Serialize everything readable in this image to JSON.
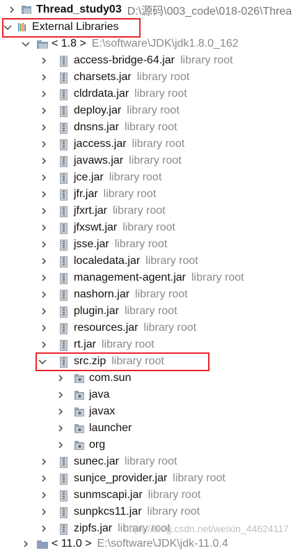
{
  "project": {
    "name": "Thread_study03",
    "path": "D:\\源码\\003_code\\018-026\\Threa"
  },
  "external_libraries": {
    "label": "External Libraries"
  },
  "jdk18": {
    "label": "< 1.8 >",
    "path": "E:\\software\\JDK\\jdk1.8.0_162"
  },
  "jars": [
    {
      "name": "access-bridge-64.jar",
      "hint": "library root"
    },
    {
      "name": "charsets.jar",
      "hint": "library root"
    },
    {
      "name": "cldrdata.jar",
      "hint": "library root"
    },
    {
      "name": "deploy.jar",
      "hint": "library root"
    },
    {
      "name": "dnsns.jar",
      "hint": "library root"
    },
    {
      "name": "jaccess.jar",
      "hint": "library root"
    },
    {
      "name": "javaws.jar",
      "hint": "library root"
    },
    {
      "name": "jce.jar",
      "hint": "library root"
    },
    {
      "name": "jfr.jar",
      "hint": "library root"
    },
    {
      "name": "jfxrt.jar",
      "hint": "library root"
    },
    {
      "name": "jfxswt.jar",
      "hint": "library root"
    },
    {
      "name": "jsse.jar",
      "hint": "library root"
    },
    {
      "name": "localedata.jar",
      "hint": "library root"
    },
    {
      "name": "management-agent.jar",
      "hint": "library root"
    },
    {
      "name": "nashorn.jar",
      "hint": "library root"
    },
    {
      "name": "plugin.jar",
      "hint": "library root"
    },
    {
      "name": "resources.jar",
      "hint": "library root"
    },
    {
      "name": "rt.jar",
      "hint": "library root"
    }
  ],
  "src_zip": {
    "name": "src.zip",
    "hint": "library root"
  },
  "packages": [
    {
      "name": "com.sun"
    },
    {
      "name": "java"
    },
    {
      "name": "javax"
    },
    {
      "name": "launcher"
    },
    {
      "name": "org"
    }
  ],
  "jars_after": [
    {
      "name": "sunec.jar",
      "hint": "library root"
    },
    {
      "name": "sunjce_provider.jar",
      "hint": "library root"
    },
    {
      "name": "sunmscapi.jar",
      "hint": "library root"
    },
    {
      "name": "sunpkcs11.jar",
      "hint": "library root"
    },
    {
      "name": "zipfs.jar",
      "hint": "library root"
    }
  ],
  "jdk11_partial": {
    "label": "< 11.0 >",
    "path": "E:\\software\\JDK\\jdk-11.0.4"
  },
  "watermark": "https://blog.csdn.net/weixin_44624117",
  "colors": {
    "highlight_box": "#e8242b",
    "hint": "#8a8a8a",
    "arrow": "#555555"
  }
}
